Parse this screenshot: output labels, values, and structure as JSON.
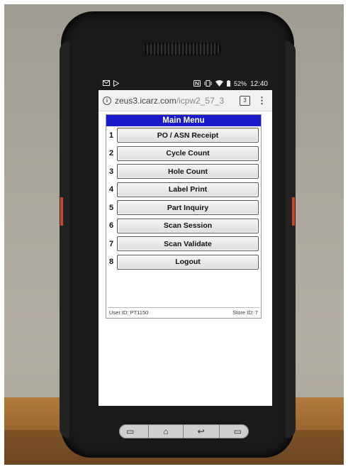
{
  "statusbar": {
    "left_icons": [
      "gmail-icon",
      "play-store-icon"
    ],
    "right_icons": [
      "nfc-icon",
      "vibrate-icon",
      "wifi-icon",
      "battery-icon"
    ],
    "battery": "52%",
    "time": "12:40"
  },
  "browser": {
    "url_host": "zeus3.icarz.com",
    "url_path": "/icpw2_57_3",
    "tab_count": "3",
    "menu_glyph": "⋮"
  },
  "menu": {
    "title": "Main Menu",
    "items": [
      {
        "num": "1",
        "label": "PO / ASN Receipt"
      },
      {
        "num": "2",
        "label": "Cycle Count"
      },
      {
        "num": "3",
        "label": "Hole Count"
      },
      {
        "num": "4",
        "label": "Label Print"
      },
      {
        "num": "5",
        "label": "Part Inquiry"
      },
      {
        "num": "6",
        "label": "Scan Session"
      },
      {
        "num": "7",
        "label": "Scan Validate"
      },
      {
        "num": "8",
        "label": "Logout"
      }
    ],
    "footer": {
      "user_id": "User ID: PT1150",
      "store_id": "Store ID: 7"
    }
  },
  "navbar": {
    "buttons": [
      {
        "name": "recents-icon",
        "glyph": "▭"
      },
      {
        "name": "home-icon",
        "glyph": "⌂"
      },
      {
        "name": "back-icon",
        "glyph": "↩"
      },
      {
        "name": "menu-key-icon",
        "glyph": "▭"
      }
    ]
  },
  "colors": {
    "menu_header": "#1a1acb",
    "phone_body": "#191919",
    "accent": "#c9472a"
  }
}
